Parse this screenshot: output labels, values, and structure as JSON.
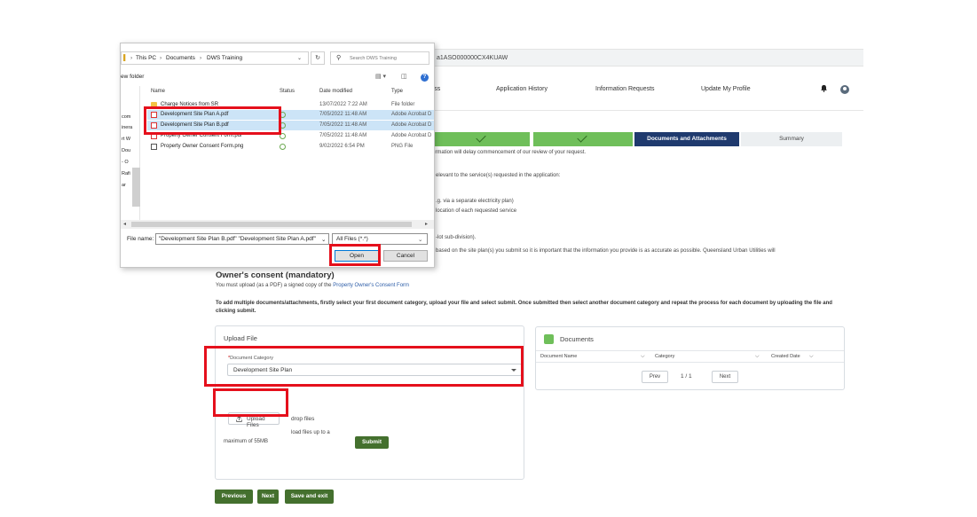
{
  "browser": {
    "url_fragment": "a1ASO000000CX4KUAW"
  },
  "portal": {
    "nav": {
      "item_progress": "ress",
      "application_history": "Application History",
      "information_requests": "Information Requests",
      "update_profile": "Update My Profile"
    },
    "stepper": {
      "current": "Documents and Attachments",
      "next": "Summary"
    },
    "partial_text": {
      "line1": "ormation will delay commencement of our review of your request.",
      "line2": "elevant to the service(s) requested in the application:",
      "line3": ".g. via a separate electricity plan)",
      "line4": "location of each requested service",
      "line5": "-lot sub-division).",
      "line6": "based on the site plan(s) you submit so it is important that the information you provide is as accurate as possible. Queensland Urban Utilities will"
    },
    "owner_consent": {
      "heading": "Owner's consent (mandatory)",
      "desc_prefix": "You must upload (as a PDF) a signed copy of the ",
      "desc_link": "Property Owner's Consent Form"
    },
    "instructions": "To add multiple documents/attachments, firstly select your first document category, upload your file and select submit. Once submitted then select another document category and repeat the process for each document by uploading the file and clicking submit.",
    "upload": {
      "title": "Upload File",
      "category_label": "Document Category",
      "category_required": "*",
      "category_value": "Development Site Plan",
      "upload_button": "Upload Files",
      "drop_text": "drop files",
      "submit": "Submit",
      "limit_line1": "load files up to a",
      "limit_line2": "maximum of 55MB"
    },
    "documents": {
      "title": "Documents",
      "columns": [
        "Document Name",
        "Category",
        "Created Date"
      ],
      "prev": "Prev",
      "page_text": "1 / 1",
      "next": "Next"
    },
    "footer": {
      "previous": "Previous",
      "next": "Next",
      "save_exit": "Save and exit"
    }
  },
  "dialog": {
    "breadcrumb": [
      "This PC",
      "Documents",
      "DWS Training"
    ],
    "search_placeholder": "Search DWS Training",
    "new_folder": "ew folder",
    "nav_items": [
      "com",
      "inera",
      "rt W",
      "Dou",
      "- O",
      "Rafi",
      "ar"
    ],
    "columns": {
      "name": "Name",
      "status": "Status",
      "date": "Date modified",
      "type": "Type"
    },
    "files": [
      {
        "name": "Charge Notices from SR",
        "date": "13/07/2022 7:22 AM",
        "type": "File folder",
        "icon": "folder-icon",
        "selected": false
      },
      {
        "name": "Development Site Plan A.pdf",
        "date": "7/05/2022 11:48 AM",
        "type": "Adobe Acrobat D",
        "icon": "pdf-icon",
        "selected": true
      },
      {
        "name": "Development Site Plan B.pdf",
        "date": "7/05/2022 11:48 AM",
        "type": "Adobe Acrobat D",
        "icon": "pdf-icon",
        "selected": true
      },
      {
        "name": "Property Owner Consent Form.pdf",
        "date": "7/05/2022 11:48 AM",
        "type": "Adobe Acrobat D",
        "icon": "pdf-icon",
        "selected": false
      },
      {
        "name": "Property Owner Consent Form.png",
        "date": "9/02/2022 6:54 PM",
        "type": "PNG File",
        "icon": "image-icon",
        "selected": false
      }
    ],
    "filename_label": "File name:",
    "filename_value": "\"Development Site Plan B.pdf\" \"Development Site Plan A.pdf\"",
    "filetype_value": "All Files (*.*)",
    "open": "Open",
    "cancel": "Cancel"
  },
  "colors": {
    "highlight": "#e5101c",
    "brand_green": "#44702e",
    "step_done": "#6fbf5a",
    "step_current": "#1f3a6e"
  }
}
